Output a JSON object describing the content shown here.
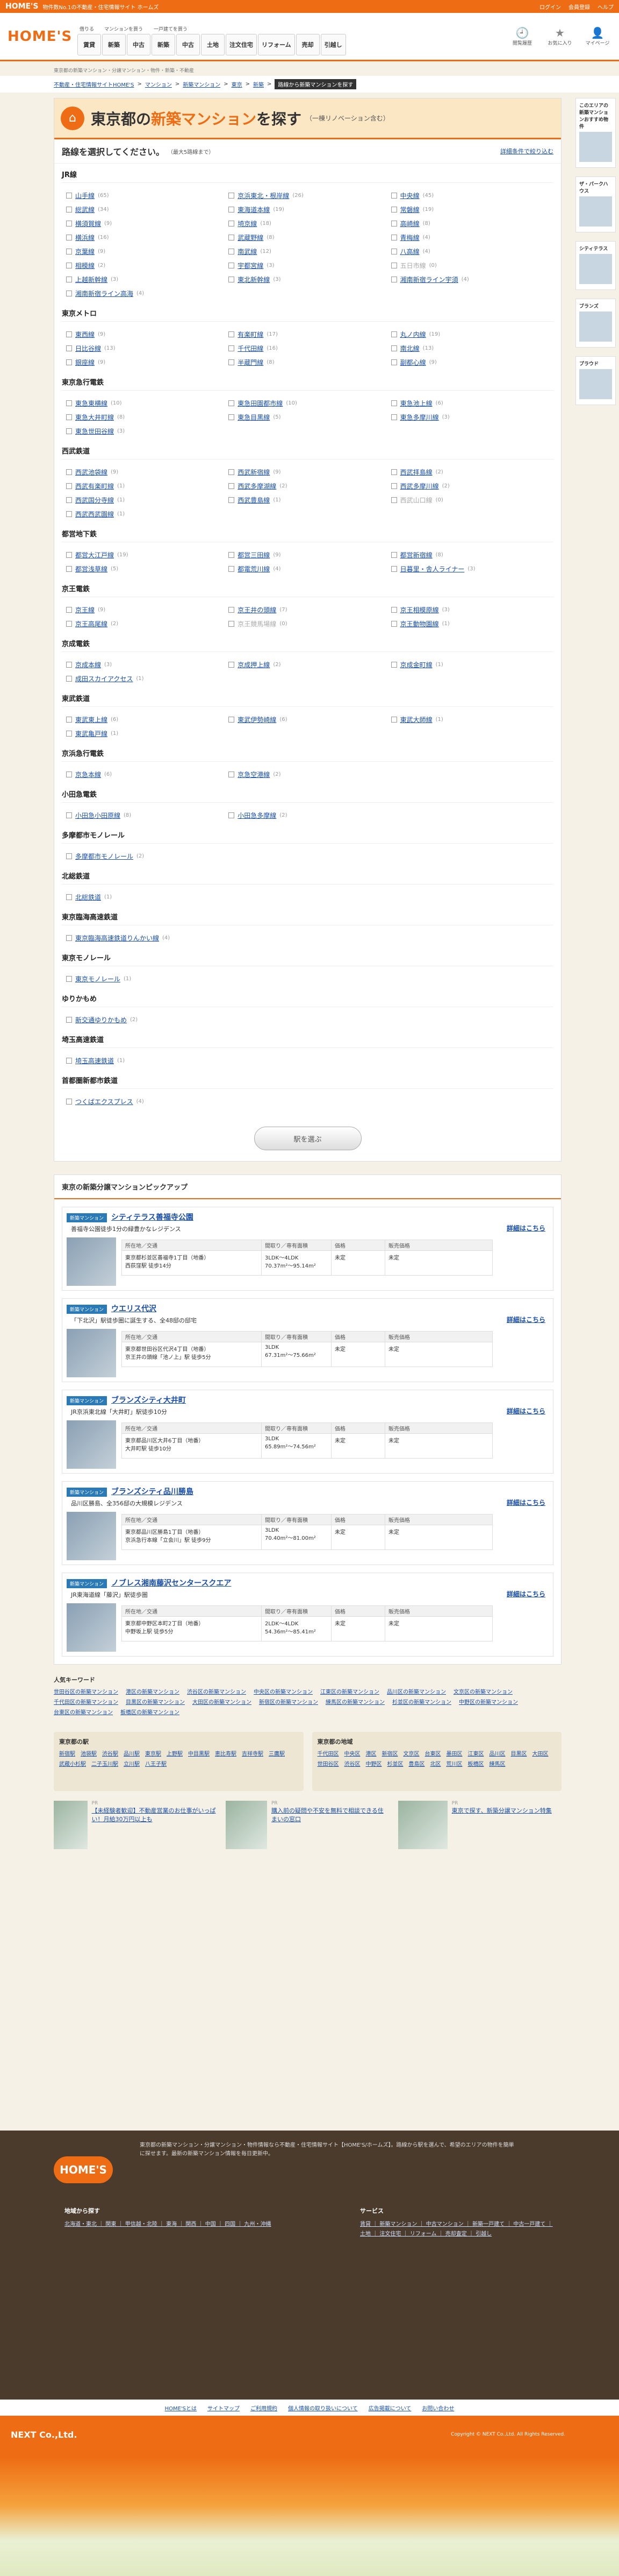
{
  "topbar": {
    "logo": "HOME'S",
    "tagline": "物件数No.1の不動産・住宅情報サイト ホームズ",
    "links": [
      "ログイン",
      "会員登録",
      "ヘルプ"
    ]
  },
  "header": {
    "logo": "HOME'S",
    "nav_groups": [
      {
        "label": "借りる",
        "items": [
          "賃貸"
        ]
      },
      {
        "label": "マンションを買う",
        "items": [
          "新築",
          "中古"
        ]
      },
      {
        "label": "一戸建てを買う",
        "items": [
          "新築",
          "中古"
        ]
      },
      {
        "label": "",
        "items": [
          "土地",
          "注文住宅",
          "リフォーム",
          "売却",
          "引越し"
        ]
      }
    ],
    "icons": [
      "閲覧履歴",
      "お気に入り",
      "マイページ"
    ]
  },
  "breadcrumb1": "東京都の新築マンション・分譲マンション・物件・新築・不動産",
  "breadcrumb2": {
    "items": [
      "不動産・住宅情報サイトHOME'S",
      "マンション",
      "新築マンション",
      "東京",
      "新築"
    ],
    "current": "路線から新築マンションを探す"
  },
  "search": {
    "title_pre": "東京都の",
    "title_hl": "新築マンション",
    "title_post": "を探す",
    "subtitle": "（一棟リノベーション含む）",
    "select_head": "路線を選択してください。",
    "select_max": "（最大5路線まで）",
    "detail_link": "詳細条件で絞り込む",
    "submit": "駅を選ぶ"
  },
  "lines": [
    {
      "group": "JR線",
      "stations": [
        {
          "n": "山手線",
          "c": "(65)"
        },
        {
          "n": "京浜東北・根岸線",
          "c": "(26)"
        },
        {
          "n": "中央線",
          "c": "(45)"
        },
        {
          "n": "総武線",
          "c": "(34)"
        },
        {
          "n": "東海道本線",
          "c": "(19)"
        },
        {
          "n": "常磐線",
          "c": "(19)"
        },
        {
          "n": "横須賀線",
          "c": "(9)"
        },
        {
          "n": "埼京線",
          "c": "(18)"
        },
        {
          "n": "高崎線",
          "c": "(8)"
        },
        {
          "n": "横浜線",
          "c": "(16)"
        },
        {
          "n": "武蔵野線",
          "c": "(8)"
        },
        {
          "n": "青梅線",
          "c": "(4)"
        },
        {
          "n": "京葉線",
          "c": "(9)"
        },
        {
          "n": "南武線",
          "c": "(12)"
        },
        {
          "n": "八高線",
          "c": "(4)"
        },
        {
          "n": "相模線",
          "c": "(2)"
        },
        {
          "n": "宇都宮線",
          "c": "(3)"
        },
        {
          "n": "五日市線",
          "c": "(0)",
          "d": true
        },
        {
          "n": "上越新幹線",
          "c": "(3)"
        },
        {
          "n": "東北新幹線",
          "c": "(3)"
        },
        {
          "n": "湘南新宿ライン宇須",
          "c": "(4)"
        },
        {
          "n": "湘南新宿ライン高海",
          "c": "(4)"
        }
      ]
    },
    {
      "group": "東京メトロ",
      "stations": [
        {
          "n": "東西線",
          "c": "(9)"
        },
        {
          "n": "有楽町線",
          "c": "(17)"
        },
        {
          "n": "丸ノ内線",
          "c": "(19)"
        },
        {
          "n": "日比谷線",
          "c": "(13)"
        },
        {
          "n": "千代田線",
          "c": "(16)"
        },
        {
          "n": "南北線",
          "c": "(13)"
        },
        {
          "n": "銀座線",
          "c": "(9)"
        },
        {
          "n": "半蔵門線",
          "c": "(8)"
        },
        {
          "n": "副都心線",
          "c": "(9)"
        }
      ]
    },
    {
      "group": "東京急行電鉄",
      "stations": [
        {
          "n": "東急東横線",
          "c": "(10)"
        },
        {
          "n": "東急田園都市線",
          "c": "(10)"
        },
        {
          "n": "東急池上線",
          "c": "(6)"
        },
        {
          "n": "東急大井町線",
          "c": "(8)"
        },
        {
          "n": "東急目黒線",
          "c": "(5)"
        },
        {
          "n": "東急多摩川線",
          "c": "(3)"
        },
        {
          "n": "東急世田谷線",
          "c": "(3)"
        }
      ]
    },
    {
      "group": "西武鉄道",
      "stations": [
        {
          "n": "西武池袋線",
          "c": "(9)"
        },
        {
          "n": "西武新宿線",
          "c": "(9)"
        },
        {
          "n": "西武拝島線",
          "c": "(2)"
        },
        {
          "n": "西武有楽町線",
          "c": "(1)"
        },
        {
          "n": "西武多摩湖線",
          "c": "(2)"
        },
        {
          "n": "西武多摩川線",
          "c": "(2)"
        },
        {
          "n": "西武国分寺線",
          "c": "(1)"
        },
        {
          "n": "西武豊島線",
          "c": "(1)"
        },
        {
          "n": "西武山口線",
          "c": "(0)",
          "d": true
        },
        {
          "n": "西武西武園線",
          "c": "(1)"
        }
      ]
    },
    {
      "group": "都営地下鉄",
      "stations": [
        {
          "n": "都営大江戸線",
          "c": "(19)"
        },
        {
          "n": "都営三田線",
          "c": "(9)"
        },
        {
          "n": "都営新宿線",
          "c": "(8)"
        },
        {
          "n": "都営浅草線",
          "c": "(5)"
        },
        {
          "n": "都電荒川線",
          "c": "(4)"
        },
        {
          "n": "日暮里・舎人ライナー",
          "c": "(3)"
        }
      ]
    },
    {
      "group": "京王電鉄",
      "stations": [
        {
          "n": "京王線",
          "c": "(9)"
        },
        {
          "n": "京王井の頭線",
          "c": "(7)"
        },
        {
          "n": "京王相模原線",
          "c": "(3)"
        },
        {
          "n": "京王高尾線",
          "c": "(2)"
        },
        {
          "n": "京王競馬場線",
          "c": "(0)",
          "d": true
        },
        {
          "n": "京王動物園線",
          "c": "(1)"
        }
      ]
    },
    {
      "group": "京成電鉄",
      "stations": [
        {
          "n": "京成本線",
          "c": "(3)"
        },
        {
          "n": "京成押上線",
          "c": "(2)"
        },
        {
          "n": "京成金町線",
          "c": "(1)"
        },
        {
          "n": "成田スカイアクセス",
          "c": "(1)"
        }
      ]
    },
    {
      "group": "東武鉄道",
      "stations": [
        {
          "n": "東武東上線",
          "c": "(6)"
        },
        {
          "n": "東武伊勢崎線",
          "c": "(6)"
        },
        {
          "n": "東武大師線",
          "c": "(1)"
        },
        {
          "n": "東武亀戸線",
          "c": "(1)"
        }
      ]
    },
    {
      "group": "京浜急行電鉄",
      "stations": [
        {
          "n": "京急本線",
          "c": "(6)"
        },
        {
          "n": "京急空港線",
          "c": "(2)"
        }
      ]
    },
    {
      "group": "小田急電鉄",
      "stations": [
        {
          "n": "小田急小田原線",
          "c": "(8)"
        },
        {
          "n": "小田急多摩線",
          "c": "(2)"
        }
      ]
    },
    {
      "group": "多摩都市モノレール",
      "stations": [
        {
          "n": "多摩都市モノレール",
          "c": "(2)"
        }
      ]
    },
    {
      "group": "北総鉄道",
      "stations": [
        {
          "n": "北総鉄道",
          "c": "(1)"
        }
      ]
    },
    {
      "group": "東京臨海高速鉄道",
      "stations": [
        {
          "n": "東京臨海高速鉄道りんかい線",
          "c": "(4)"
        }
      ]
    },
    {
      "group": "東京モノレール",
      "stations": [
        {
          "n": "東京モノレール",
          "c": "(1)"
        }
      ]
    },
    {
      "group": "ゆりかもめ",
      "stations": [
        {
          "n": "新交通ゆりかもめ",
          "c": "(2)"
        }
      ]
    },
    {
      "group": "埼玉高速鉄道",
      "stations": [
        {
          "n": "埼玉高速鉄道",
          "c": "(1)"
        }
      ]
    },
    {
      "group": "首都圏新都市鉄道",
      "stations": [
        {
          "n": "つくばエクスプレス",
          "c": "(4)"
        }
      ]
    }
  ],
  "pickup": {
    "title": "東京の新築分譲マンションピックアップ",
    "headers": [
      "所在地／交通",
      "間取り／専有面積",
      "価格",
      "販売価格"
    ],
    "detail_label": "詳細はこちら",
    "items": [
      {
        "tag": "新築マンション",
        "name": "シティテラス善福寺公園",
        "catch": "善福寺公園徒歩1分の緑豊かなレジデンス",
        "addr": "東京都杉並区善福寺1丁目（地番）\n西荻窪駅 徒歩14分",
        "plan": "3LDK〜4LDK\n70.37m²〜95.14m²",
        "units": "未定",
        "price": "未定"
      },
      {
        "tag": "新築マンション",
        "name": "ウエリス代沢",
        "catch": "「下北沢」駅徒歩圏に誕生する、全48邸の邸宅",
        "addr": "東京都世田谷区代沢4丁目（地番）\n京王井の頭線「池ノ上」駅 徒歩5分",
        "plan": "3LDK\n67.31m²〜75.66m²",
        "units": "未定",
        "price": "未定"
      },
      {
        "tag": "新築マンション",
        "name": "ブランズシティ大井町",
        "catch": "JR京浜東北線「大井町」駅徒歩10分",
        "addr": "東京都品川区大井6丁目（地番）\n大井町駅 徒歩10分",
        "plan": "3LDK\n65.89m²〜74.56m²",
        "units": "未定",
        "price": "未定"
      },
      {
        "tag": "新築マンション",
        "name": "ブランズシティ品川勝島",
        "catch": "品川区勝島、全356邸の大規模レジデンス",
        "addr": "東京都品川区勝島1丁目（地番）\n京浜急行本線「立会川」駅 徒歩9分",
        "plan": "3LDK\n70.40m²〜81.00m²",
        "units": "未定",
        "price": "未定"
      },
      {
        "tag": "新築マンション",
        "name": "ノブレス湘南藤沢センタースクエア",
        "catch": "JR東海道線「藤沢」駅徒歩圏",
        "addr": "東京都中野区本町2丁目（地番）\n中野坂上駅 徒歩5分",
        "plan": "2LDK〜4LDK\n54.36m²〜85.41m²",
        "units": "未定",
        "price": "未定"
      }
    ]
  },
  "keywords": {
    "title": "人気キーワード",
    "links": [
      "世田谷区の新築マンション",
      "港区の新築マンション",
      "渋谷区の新築マンション",
      "中央区の新築マンション",
      "江東区の新築マンション",
      "品川区の新築マンション",
      "文京区の新築マンション",
      "千代田区の新築マンション",
      "目黒区の新築マンション",
      "大田区の新築マンション",
      "新宿区の新築マンション",
      "練馬区の新築マンション",
      "杉並区の新築マンション",
      "中野区の新築マンション",
      "台東区の新築マンション",
      "板橋区の新築マンション"
    ]
  },
  "areas": [
    {
      "title": "東京都の駅",
      "links": [
        "新宿駅",
        "池袋駅",
        "渋谷駅",
        "品川駅",
        "東京駅",
        "上野駅",
        "中目黒駅",
        "恵比寿駅",
        "吉祥寺駅",
        "三鷹駅",
        "武蔵小杉駅",
        "二子玉川駅",
        "立川駅",
        "八王子駅"
      ]
    },
    {
      "title": "東京都の地域",
      "links": [
        "千代田区",
        "中央区",
        "港区",
        "新宿区",
        "文京区",
        "台東区",
        "墨田区",
        "江東区",
        "品川区",
        "目黒区",
        "大田区",
        "世田谷区",
        "渋谷区",
        "中野区",
        "杉並区",
        "豊島区",
        "北区",
        "荒川区",
        "板橋区",
        "練馬区"
      ]
    }
  ],
  "promos": [
    {
      "pr": "PR",
      "text": "【未経験者歓迎】不動産営業のお仕事がいっぱい！月給30万円以上も"
    },
    {
      "pr": "PR",
      "text": "購入前の疑問や不安を無料で相談できる住まいの窓口"
    },
    {
      "pr": "PR",
      "text": "東京で探す、新築分譲マンション特集"
    }
  ],
  "side": [
    {
      "h": "このエリアの新築マンションおすすめ物件"
    },
    {
      "h": "ザ・パークハウス"
    },
    {
      "h": "シティテラス"
    },
    {
      "h": "ブランズ"
    },
    {
      "h": "プラウド"
    }
  ],
  "footer": {
    "logo": "HOME'S",
    "desc": "東京都の新築マンション・分譲マンション・物件情報なら不動産・住宅情報サイト【HOME'S/ホームズ】。路線から駅を選んで、希望のエリアの物件を簡単に探せます。最新の新築マンション情報を毎日更新中。",
    "boxes": [
      {
        "title": "地域から探す",
        "text": "北海道・東北 ｜ 関東 ｜ 甲信越・北陸 ｜ 東海 ｜ 関西 ｜ 中国 ｜ 四国 ｜ 九州・沖縄"
      },
      {
        "title": "サービス",
        "text": "賃貸 ｜ 新築マンション ｜ 中古マンション ｜ 新築一戸建て ｜ 中古一戸建て ｜ 土地 ｜ 注文住宅 ｜ リフォーム ｜ 売却査定 ｜ 引越し"
      }
    ],
    "nav": [
      "HOME'Sとは",
      "サイトマップ",
      "ご利用規約",
      "個人情報の取り扱いについて",
      "広告掲載について",
      "お問い合わせ"
    ],
    "company": "NEXT Co.,Ltd.",
    "copyright": "Copyright © NEXT Co.,Ltd. All Rights Reserved."
  }
}
